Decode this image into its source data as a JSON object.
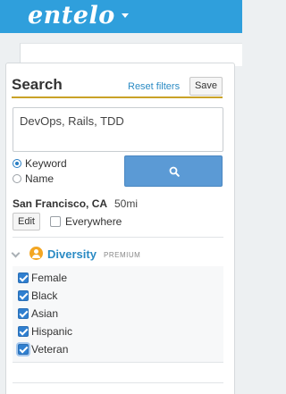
{
  "header": {
    "logo": "entelo"
  },
  "search": {
    "title": "Search",
    "reset_label": "Reset filters",
    "save_label": "Save",
    "query": "DevOps, Rails, TDD",
    "mode_options": [
      "Keyword",
      "Name"
    ],
    "mode_selected": "Keyword"
  },
  "location": {
    "city": "San Francisco, CA",
    "radius": "50mi",
    "edit_label": "Edit",
    "everywhere_label": "Everywhere",
    "everywhere_checked": false
  },
  "diversity": {
    "title": "Diversity",
    "badge": "PREMIUM",
    "options": [
      {
        "label": "Female",
        "checked": true
      },
      {
        "label": "Black",
        "checked": true
      },
      {
        "label": "Asian",
        "checked": true
      },
      {
        "label": "Hispanic",
        "checked": true
      },
      {
        "label": "Veteran",
        "checked": true
      }
    ]
  },
  "colors": {
    "brand": "#2f9fdc",
    "link": "#2b8bc4",
    "button": "#5b9ad5",
    "accent": "#c9a227",
    "premium_icon": "#f3a623"
  }
}
